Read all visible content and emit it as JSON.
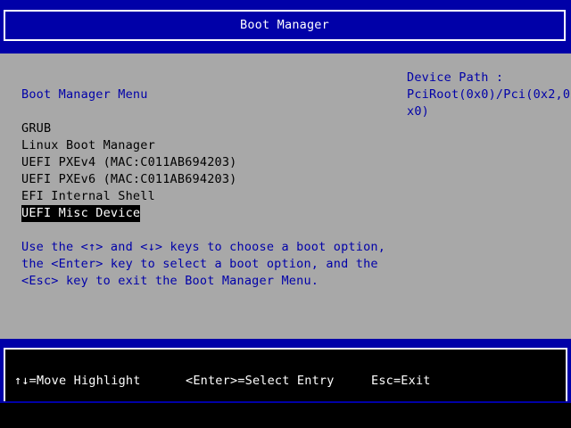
{
  "header": {
    "title": "Boot Manager"
  },
  "main": {
    "menu_title": "Boot Manager Menu",
    "device_path": {
      "label": "Device Path :",
      "line1": "PciRoot(0x0)/Pci(0x2,0",
      "line2": "x0)"
    },
    "boot_options": [
      {
        "label": "GRUB",
        "selected": false
      },
      {
        "label": "Linux Boot Manager",
        "selected": false
      },
      {
        "label": "UEFI PXEv4 (MAC:C011AB694203)",
        "selected": false
      },
      {
        "label": "UEFI PXEv6 (MAC:C011AB694203)",
        "selected": false
      },
      {
        "label": "EFI Internal Shell",
        "selected": false
      },
      {
        "label": "UEFI Misc Device",
        "selected": true
      }
    ],
    "help_lines": [
      "Use the <↑> and <↓> keys to choose a boot option,",
      "the <Enter> key to select a boot option, and the",
      "<Esc> key to exit the Boot Manager Menu."
    ]
  },
  "footer": {
    "move_hint": "↑↓=Move Highlight",
    "select_hint": "<Enter>=Select Entry",
    "exit_hint": "Esc=Exit"
  },
  "colors": {
    "header_bg": "#0000a8",
    "body_bg": "#a8a8a8",
    "text_blue": "#0000a8",
    "highlight_bg": "#000000",
    "highlight_fg": "#ffffff"
  }
}
